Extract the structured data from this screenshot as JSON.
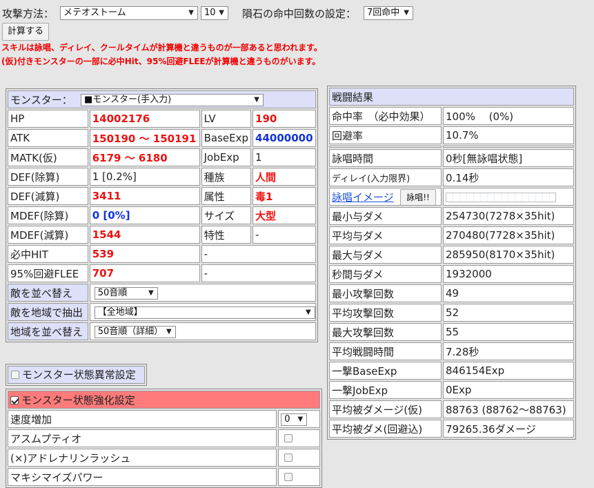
{
  "top": {
    "attack_label": "攻撃方法：",
    "attack_value": "メテオストーム",
    "level_value": "10",
    "hit_label": "隕石の命中回数の設定：",
    "hit_value": "7回命中",
    "calc_button": "計算する",
    "warning1": "スキルは詠唱、ディレイ、クールタイムが計算機と違うものが一部あると思われます。",
    "warning2": "(仮)付きモンスターの一部に必中Hit、95%回避FLEEが計算機と違うものがいます。"
  },
  "monster": {
    "label": "モンスター：",
    "select": "■モンスター(手入力)",
    "rows": [
      {
        "l1": "HP",
        "v1": "14002176",
        "l2": "LV",
        "v2": "190"
      },
      {
        "l1": "ATK",
        "v1": "150190 ～ 150191",
        "l2": "BaseExp",
        "v2": "44000000"
      },
      {
        "l1": "MATK(仮)",
        "v1": "6179 ～ 6180",
        "l2": "JobExp",
        "v2": "1"
      },
      {
        "l1": "DEF(除算)",
        "v1": "1 [0.2%]",
        "l2": "種族",
        "v2": "人間"
      },
      {
        "l1": "DEF(減算)",
        "v1": "3411",
        "l2": "属性",
        "v2": "毒1"
      },
      {
        "l1": "MDEF(除算)",
        "v1": "0 [0%]",
        "l2": "サイズ",
        "v2": "大型"
      },
      {
        "l1": "MDEF(減算)",
        "v1": "1544",
        "l2": "特性",
        "v2": "-"
      },
      {
        "l1": "必中HIT",
        "v1": "539",
        "l2": "-"
      },
      {
        "l1": "95%回避FLEE",
        "v1": "707",
        "l2": "-"
      }
    ],
    "sort_label": "敵を並べ替え",
    "sort_value": "50音順",
    "region_label": "敵を地域で抽出",
    "region_value": "【全地域】",
    "region_sort_label": "地域を並べ替え",
    "region_sort_value": "50音順（詳細）"
  },
  "status_abnormal": {
    "label": "モンスター状態異常設定"
  },
  "status_buff": {
    "label": "モンスター状態強化設定",
    "rows": [
      {
        "label": "速度増加",
        "value": "0"
      },
      {
        "label": "アスムプティオ"
      },
      {
        "label": "(×)アドレナリンラッシュ"
      },
      {
        "label": "マキシマイズパワー"
      }
    ]
  },
  "battle": {
    "title": "戦闘結果",
    "hit_label": "命中率　（必中効果）",
    "hit_value": "100%　 (0%)",
    "flee_label": "回避率",
    "flee_value": "10.7%",
    "cast_label": "詠唱時間",
    "cast_value": "0秒[無詠唱状態]",
    "delay_label": "ディレイ(入力限界)",
    "delay_value": "0.14秒",
    "cast_image_link": "詠唱イメージ",
    "cast_button": "詠唱!!",
    "results": [
      {
        "label": "最小与ダメ",
        "value": "254730(7278×35hit)"
      },
      {
        "label": "平均与ダメ",
        "value": "270480(7728×35hit)"
      },
      {
        "label": "最大与ダメ",
        "value": "285950(8170×35hit)"
      },
      {
        "label": "秒間与ダメ",
        "value": "1932000"
      },
      {
        "label": "最小攻撃回数",
        "value": "49"
      },
      {
        "label": "平均攻撃回数",
        "value": "52"
      },
      {
        "label": "最大攻撃回数",
        "value": "55"
      },
      {
        "label": "平均戦闘時間",
        "value": "7.28秒"
      },
      {
        "label": "一撃BaseExp",
        "value": "846154Exp"
      },
      {
        "label": "一撃JobExp",
        "value": "0Exp"
      },
      {
        "label": "平均被ダメージ(仮)",
        "value": "88763 (88762～88763)"
      },
      {
        "label": "平均被ダメ(回避込)",
        "value": "79265.36ダメージ"
      }
    ]
  },
  "colors": {
    "red": "#ee1111",
    "blue": "#1133dd",
    "header": "#dde0f8",
    "buff_header": "#ff7b7b"
  }
}
